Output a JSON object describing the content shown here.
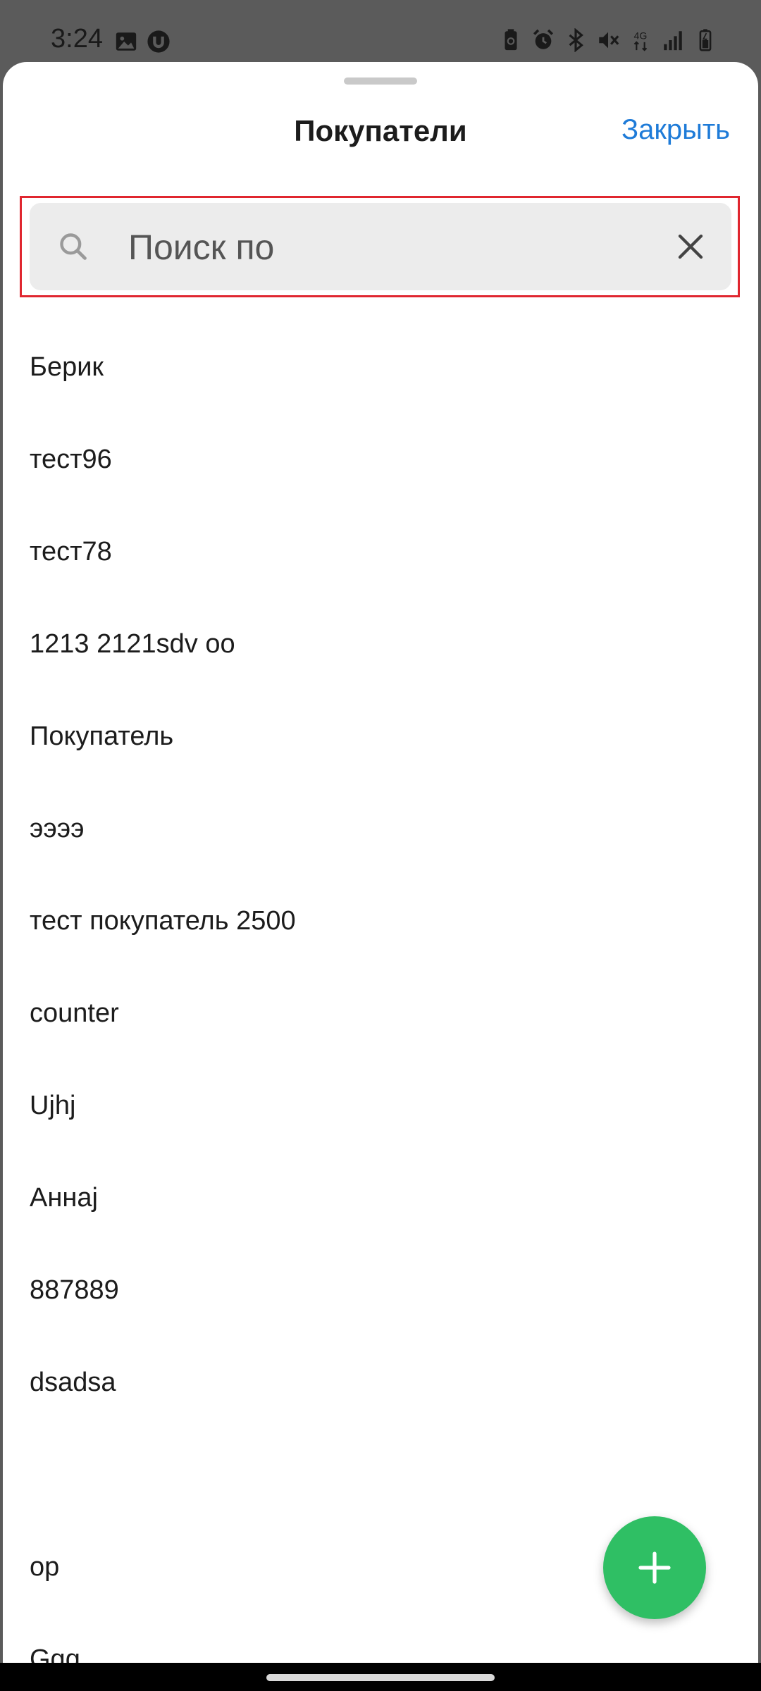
{
  "status_bar": {
    "time": "3:24",
    "network_label": "4G",
    "left_icons": [
      "gallery-icon",
      "u-app-icon"
    ],
    "right_icons": [
      "battery-saver-icon",
      "alarm-icon",
      "bluetooth-icon",
      "mute-icon",
      "4g-icon",
      "signal-icon",
      "battery-icon"
    ]
  },
  "sheet": {
    "title": "Покупатели",
    "close_label": "Закрыть"
  },
  "search": {
    "placeholder": "Поиск по",
    "value": ""
  },
  "customers": [
    "Берик",
    "тест96",
    "тест78",
    "1213 2121sdv oo",
    "Покупатель",
    "ээээ",
    "тест покупатель 2500",
    "counter",
    "Ujhj",
    "Аннаj",
    "887889",
    "dsadsa",
    "",
    "op",
    "Ggg"
  ],
  "colors": {
    "accent": "#1e7bd8",
    "fab": "#2fbf64",
    "highlight": "#e0262f"
  }
}
